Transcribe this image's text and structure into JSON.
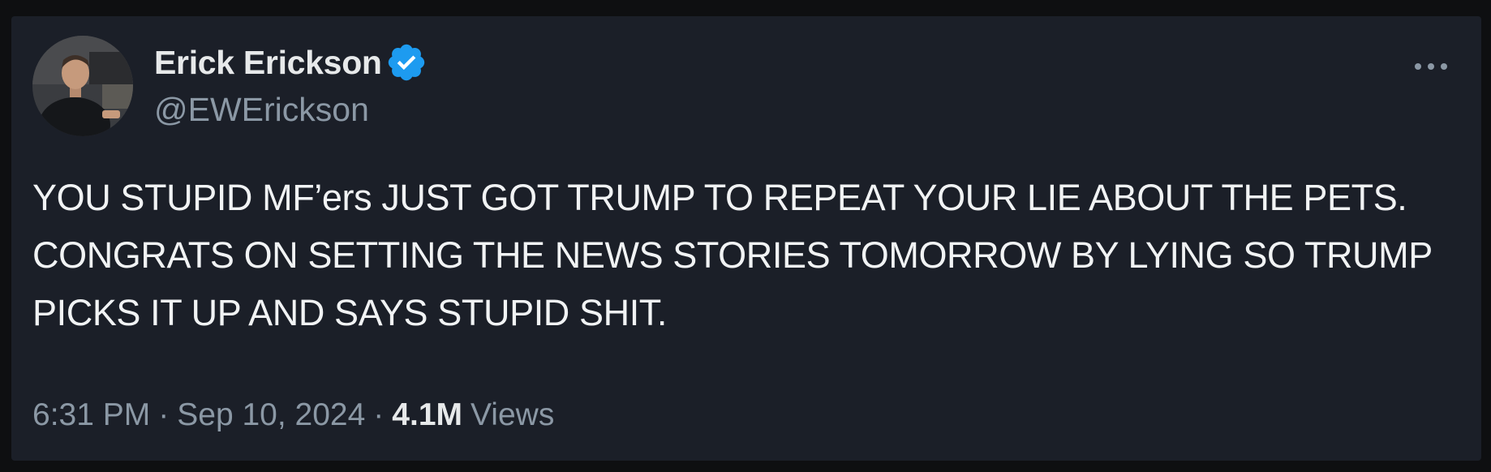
{
  "author": {
    "name": "Erick Erickson",
    "handle": "@EWErickson",
    "verified": true,
    "verified_color": "#1d9bf0"
  },
  "tweet": {
    "text": "YOU STUPID MF’ers JUST GOT TRUMP TO REPEAT YOUR LIE ABOUT THE PETS.  CONGRATS ON SETTING THE NEWS STORIES TOMORROW BY LYING SO TRUMP PICKS IT UP AND SAYS STUPID SHIT.",
    "time": "6:31 PM",
    "date": "Sep 10, 2024",
    "separator": "·",
    "views_count": "4.1M",
    "views_label": "Views"
  },
  "icons": {
    "more": "more-horizontal-icon",
    "verified": "verified-badge-icon"
  },
  "colors": {
    "background": "#1b1f28",
    "text": "#e7e9ea",
    "secondary_text": "#8b98a5"
  }
}
